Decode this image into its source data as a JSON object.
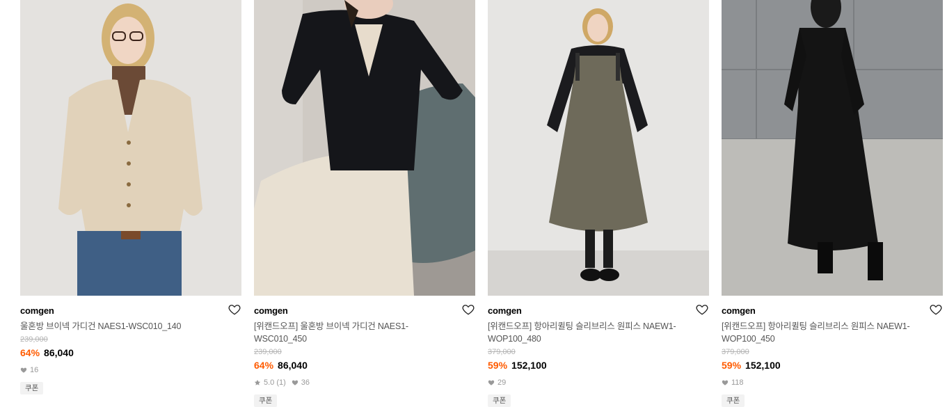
{
  "products": [
    {
      "brand": "comgen",
      "name": "울혼방 브이넥 가디건 NAES1-WSC010_140",
      "original_price": "239,000",
      "discount": "64%",
      "price": "86,040",
      "rating": null,
      "likes": "16",
      "badge": "쿠폰",
      "image_alt": "beige v-neck cardigan over brown turtleneck with jeans"
    },
    {
      "brand": "comgen",
      "name": "[위캔드오프] 울혼방 브이넥 가디건 NAES1-WSC010_450",
      "original_price": "239,000",
      "discount": "64%",
      "price": "86,040",
      "rating": "5.0 (1)",
      "likes": "36",
      "badge": "쿠폰",
      "image_alt": "black v-neck cardigan with ivory skirt seated on chair"
    },
    {
      "brand": "comgen",
      "name": "[위캔드오프] 항아리퀼팅 슬리브리스 원피스 NAEW1-WOP100_480",
      "original_price": "379,000",
      "discount": "59%",
      "price": "152,100",
      "rating": null,
      "likes": "29",
      "badge": "쿠폰",
      "image_alt": "khaki quilted sleeveless dress over black turtleneck"
    },
    {
      "brand": "comgen",
      "name": "[위캔드오프] 항아리퀼팅 슬리브리스 원피스 NAEW1-WOP100_450",
      "original_price": "379,000",
      "discount": "59%",
      "price": "152,100",
      "rating": null,
      "likes": "118",
      "badge": "쿠폰",
      "image_alt": "black quilted sleeveless dress against grey wall"
    }
  ],
  "icons": {
    "like": "heart-outline-icon",
    "likes_count": "heart-filled-icon",
    "rating": "star-icon"
  },
  "colors": {
    "discount": "#ff5b00",
    "price": "#000000",
    "original_price": "#b3b3b3",
    "badge_bg": "#f2f2f2"
  }
}
